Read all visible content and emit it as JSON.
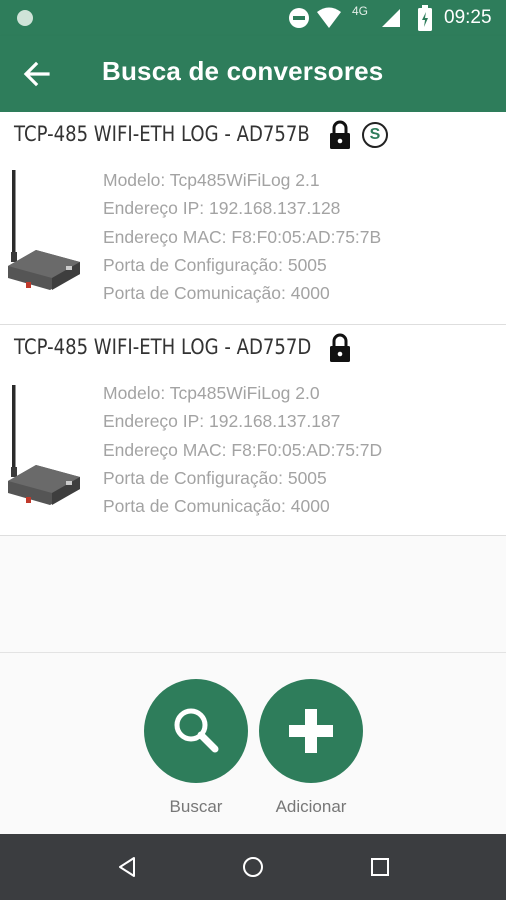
{
  "status_bar": {
    "time": "09:25",
    "network_label": "4G",
    "icons": [
      "notification-dot-icon",
      "do-not-disturb-icon",
      "wifi-icon",
      "signal-icon",
      "battery-charging-icon"
    ]
  },
  "app_bar": {
    "back_icon": "arrow-left-icon",
    "title": "Busca de conversores"
  },
  "converters": [
    {
      "name": "TCP-485 WIFI-ETH LOG - AD757B",
      "locked": true,
      "badge": "S",
      "details": [
        "Modelo: Tcp485WiFiLog 2.1",
        "Endereço IP: 192.168.137.128",
        "Endereço MAC: F8:F0:05:AD:75:7B",
        "Porta de Configuração: 5005",
        "Porta de Comunicação: 4000"
      ]
    },
    {
      "name": "TCP-485 WIFI-ETH LOG - AD757D",
      "locked": true,
      "details": [
        "Modelo: Tcp485WiFiLog 2.0",
        "Endereço IP: 192.168.137.187",
        "Endereço MAC: F8:F0:05:AD:75:7D",
        "Porta de Configuração: 5005",
        "Porta de Comunicação: 4000"
      ]
    }
  ],
  "actions": {
    "search_label": "Buscar",
    "add_label": "Adicionar"
  },
  "colors": {
    "primary": "#2e7d5b",
    "detail_text": "#a3a3a3",
    "nav_bar": "#3b3d40"
  }
}
